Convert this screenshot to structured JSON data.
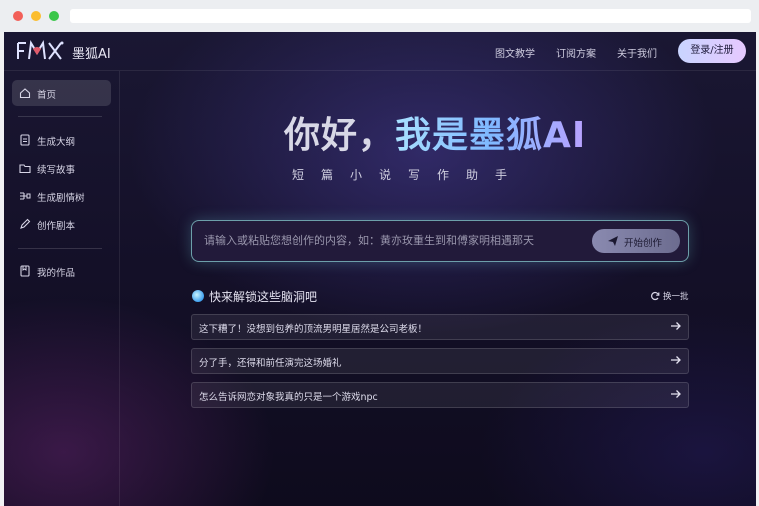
{
  "brand": {
    "name": "墨狐AI",
    "logo_text": "FMX"
  },
  "nav": {
    "tutorial": "图文教学",
    "plans": "订阅方案",
    "about": "关于我们",
    "login": "登录/注册"
  },
  "sidebar": {
    "home": "首页",
    "outline": "生成大纲",
    "continue": "续写故事",
    "plot_tree": "生成剧情树",
    "script": "创作剧本",
    "works": "我的作品"
  },
  "hero": {
    "title_prefix": "你好，",
    "title_highlight": "我是墨狐AI",
    "subtitle": "短篇小说写作助手"
  },
  "prompt": {
    "placeholder": "请输入或粘贴您想创作的内容，如：黄亦玫重生到和傅家明相遇那天",
    "start_label": "开始创作"
  },
  "ideas": {
    "title": "快来解锁这些脑洞吧",
    "refresh_label": "换一批",
    "items": [
      "这下糟了！没想到包养的顶流男明星居然是公司老板！",
      "分了手，还得和前任演完这场婚礼",
      "怎么告诉网恋对象我真的只是一个游戏npc"
    ]
  },
  "colors": {
    "accent_cyan": "#96e6e6",
    "login_gradient": [
      "#c9d4ff",
      "#e6c9ff"
    ],
    "title_gradient": [
      "#a8e0ff",
      "#b9a2ff"
    ]
  }
}
